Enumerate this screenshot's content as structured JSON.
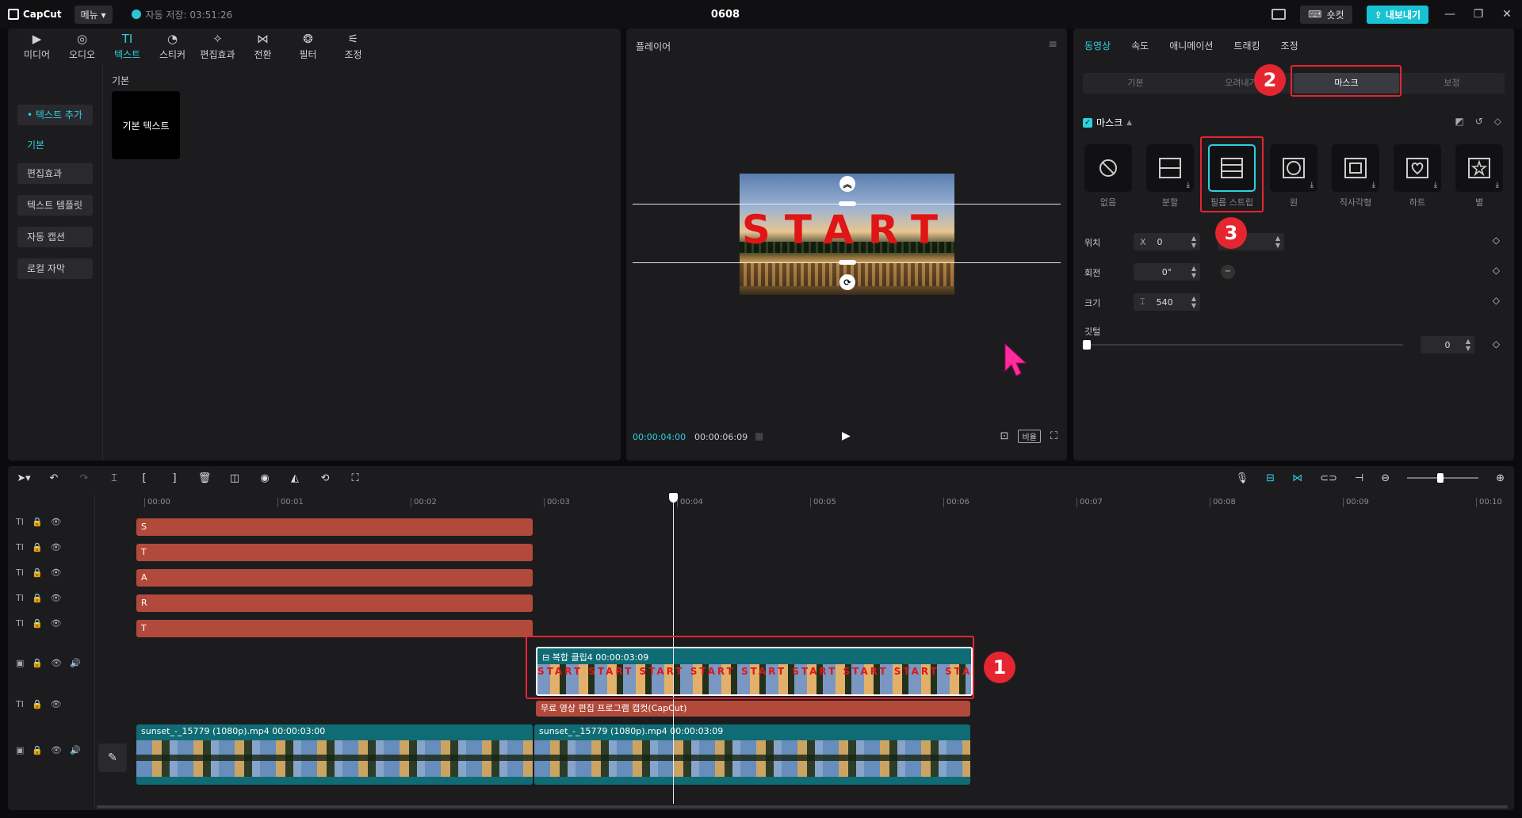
{
  "titlebar": {
    "logo": "CapCut",
    "menu_label": "메뉴",
    "autosave": "자동 저장: 03:51:26",
    "project_name": "0608",
    "shortcut_label": "숏컷",
    "export_label": "내보내기"
  },
  "left_tabs": [
    {
      "label": "미디어",
      "icon": "▶"
    },
    {
      "label": "오디오",
      "icon": "◎"
    },
    {
      "label": "텍스트",
      "icon": "TI"
    },
    {
      "label": "스티커",
      "icon": "◔"
    },
    {
      "label": "편집효과",
      "icon": "✧"
    },
    {
      "label": "전환",
      "icon": "⋈"
    },
    {
      "label": "필터",
      "icon": "❂"
    },
    {
      "label": "조정",
      "icon": "⚟"
    }
  ],
  "left_sidebar": {
    "add_text": "• 텍스트 추가",
    "basic": "기본",
    "effects": "편집효과",
    "templates": "텍스트 템플릿",
    "captions": "자동 캡션",
    "local": "로컬 자막"
  },
  "left_content": {
    "section_title": "기본",
    "tile_label": "기본 텍스트"
  },
  "player": {
    "title": "플레이어",
    "overlay_text": "START",
    "current_time": "00:00:04:00",
    "duration": "00:00:06:09",
    "ratio_label": "비율"
  },
  "right_tabs": [
    "동영상",
    "속도",
    "애니메이션",
    "트래킹",
    "조정"
  ],
  "sub_tabs": [
    "기본",
    "오려내기",
    "마스크",
    "보정"
  ],
  "mask": {
    "title": "마스크",
    "options": [
      {
        "label": "없음",
        "icon": "no-mask-icon"
      },
      {
        "label": "분할",
        "icon": "split-icon"
      },
      {
        "label": "필름 스트립",
        "icon": "film-strip-icon"
      },
      {
        "label": "원",
        "icon": "circle-icon"
      },
      {
        "label": "직사각형",
        "icon": "rectangle-icon"
      },
      {
        "label": "하트",
        "icon": "heart-icon"
      },
      {
        "label": "별",
        "icon": "star-icon"
      }
    ],
    "position_label": "위치",
    "x_prefix": "X",
    "x_value": "0",
    "y_value": "0",
    "rotation_label": "회전",
    "rotation_value": "0°",
    "size_label": "크기",
    "size_value": "540",
    "feather_label": "깃털",
    "feather_value": "0"
  },
  "annotations": [
    "1",
    "2",
    "3"
  ],
  "ruler": [
    "00:00",
    "00:01",
    "00:02",
    "00:03",
    "00:04",
    "00:05",
    "00:06",
    "00:07",
    "00:08",
    "00:09",
    "00:10"
  ],
  "tracks": {
    "text_clips": [
      "S",
      "T",
      "A",
      "R",
      "T"
    ],
    "compound_label": "복합 클립4  00:00:03:09",
    "compound_text": "START START START START START START START START START START START",
    "caption_clip": "무료 영상 편집 프로그램 캡컷(CapCut)",
    "video_clip_1": "sunset_-_15779 (1080p).mp4  00:00:03:00",
    "video_clip_2": "sunset_-_15779 (1080p).mp4  00:00:03:09"
  },
  "colors": {
    "accent": "#2fd0e0",
    "annotation_red": "#e5252f",
    "text_clip": "#b24a3b",
    "video_clip": "#0f6c74"
  }
}
